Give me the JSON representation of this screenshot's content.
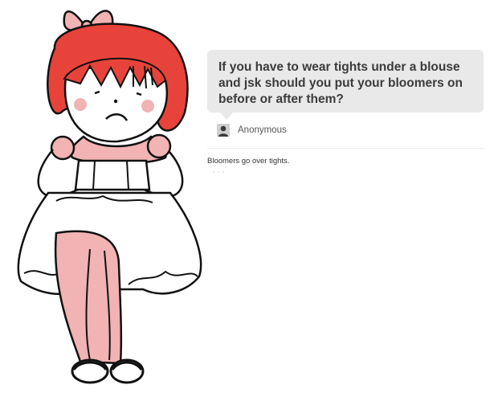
{
  "post": {
    "question": "If you have to wear tights under a blouse and jsk should you put your bloomers on before or after them?",
    "asker": {
      "name": "Anonymous",
      "avatar_icon": "silhouette-avatar-icon"
    },
    "answer": "Bloomers go over tights."
  },
  "illustration": {
    "subject": "drawn girl in lolita dress with red hair and bow",
    "colors": {
      "hair": "#e8433a",
      "skin_pink": "#f1b3b3",
      "outline": "#111111",
      "bubble_bg": "#e9e9ea"
    }
  }
}
